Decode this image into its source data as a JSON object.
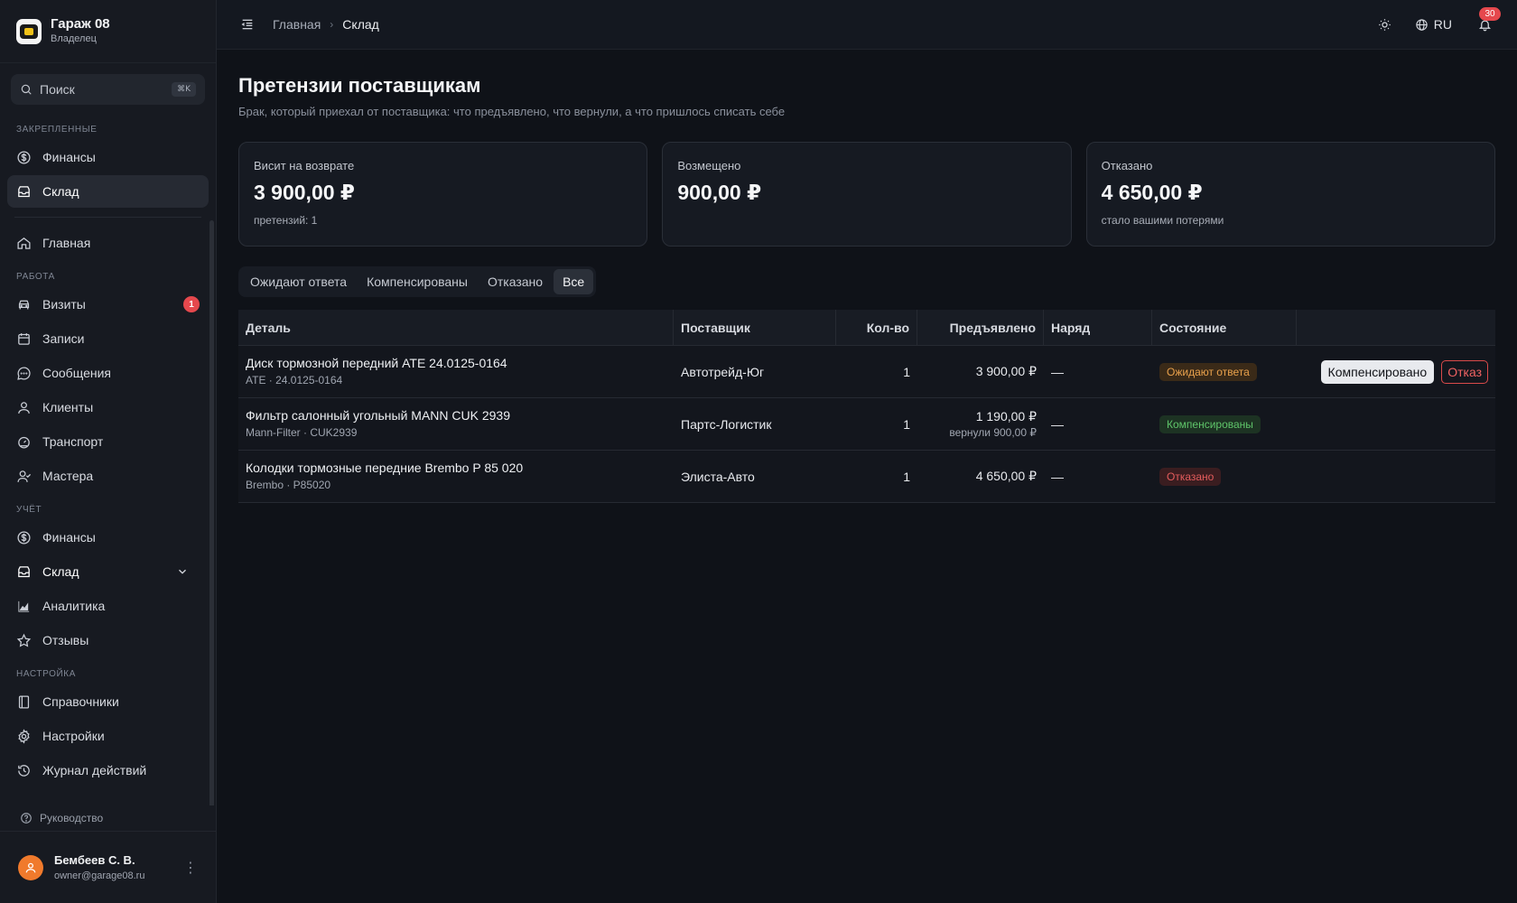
{
  "brand": {
    "title": "Гараж 08",
    "role": "Владелец"
  },
  "search": {
    "placeholder": "Поиск",
    "shortcut": "⌘K"
  },
  "sidebar": {
    "pinned_label": "ЗАКРЕПЛЕННЫЕ",
    "pinned": [
      {
        "label": "Финансы",
        "icon": "dollar-circle-icon"
      },
      {
        "label": "Склад",
        "icon": "box-icon"
      }
    ],
    "home": {
      "label": "Главная",
      "icon": "home-icon"
    },
    "work_label": "РАБОТА",
    "work": [
      {
        "label": "Визиты",
        "icon": "car-icon",
        "badge": "1"
      },
      {
        "label": "Записи",
        "icon": "calendar-icon"
      },
      {
        "label": "Сообщения",
        "icon": "chat-icon"
      },
      {
        "label": "Клиенты",
        "icon": "user-icon"
      },
      {
        "label": "Транспорт",
        "icon": "gauge-icon"
      },
      {
        "label": "Мастера",
        "icon": "users-icon"
      }
    ],
    "accounting_label": "УЧЁТ",
    "accounting": [
      {
        "label": "Финансы",
        "icon": "dollar-circle-icon"
      },
      {
        "label": "Склад",
        "icon": "box-icon"
      },
      {
        "label": "Аналитика",
        "icon": "chart-icon"
      },
      {
        "label": "Отзывы",
        "icon": "star-icon"
      }
    ],
    "settings_label": "НАСТРОЙКА",
    "settings": [
      {
        "label": "Справочники",
        "icon": "book-icon"
      },
      {
        "label": "Настройки",
        "icon": "gear-icon"
      },
      {
        "label": "Журнал действий",
        "icon": "history-icon"
      }
    ],
    "guide": "Руководство"
  },
  "user": {
    "name": "Бембеев С. В.",
    "email": "owner@garage08.ru"
  },
  "topbar": {
    "breadcrumb": [
      "Главная",
      "Склад"
    ],
    "lang": "RU",
    "notifications": "30"
  },
  "page": {
    "title": "Претензии поставщикам",
    "subtitle": "Брак, который приехал от поставщика: что предъявлено, что вернули, а что пришлось списать себе"
  },
  "cards": [
    {
      "label": "Висит на возврате",
      "value": "3 900,00 ₽",
      "note": "претензий: 1"
    },
    {
      "label": "Возмещено",
      "value": "900,00 ₽",
      "note": ""
    },
    {
      "label": "Отказано",
      "value": "4 650,00 ₽",
      "note": "стало вашими потерями"
    }
  ],
  "tabs": [
    "Ожидают ответа",
    "Компенсированы",
    "Отказано",
    "Все"
  ],
  "table": {
    "headers": [
      "Деталь",
      "Поставщик",
      "Кол-во",
      "Предъявлено",
      "Наряд",
      "Состояние",
      ""
    ],
    "rows": [
      {
        "part": "Диск тормозной передний ATE 24.0125-0164",
        "part_sub": "ATE · 24.0125-0164",
        "supplier": "Автотрейд-Юг",
        "qty": "1",
        "claimed": "3 900,00 ₽",
        "claimed_sub": "",
        "order": "—",
        "state": "Ожидают ответа",
        "actions": {
          "compensate": "Компенсировано",
          "refuse": "Отказ"
        }
      },
      {
        "part": "Фильтр салонный угольный MANN CUK 2939",
        "part_sub": "Mann-Filter · CUK2939",
        "supplier": "Партс-Логистик",
        "qty": "1",
        "claimed": "1 190,00 ₽",
        "claimed_sub": "вернули 900,00 ₽",
        "order": "—",
        "state": "Компенсированы"
      },
      {
        "part": "Колодки тормозные передние Brembo P 85 020",
        "part_sub": "Brembo · P85020",
        "supplier": "Элиста-Авто",
        "qty": "1",
        "claimed": "4 650,00 ₽",
        "claimed_sub": "",
        "order": "—",
        "state": "Отказано"
      }
    ]
  }
}
